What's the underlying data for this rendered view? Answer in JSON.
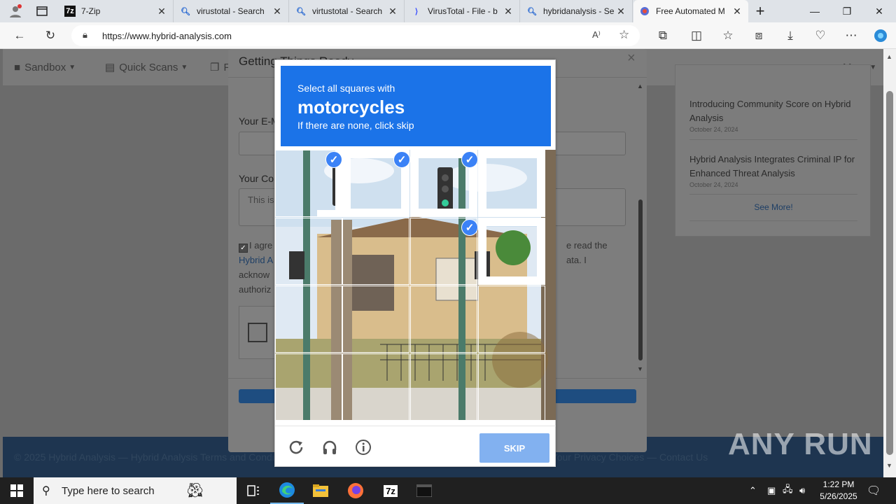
{
  "tabs": [
    {
      "label": "7-Zip",
      "icon": "7zip-icon"
    },
    {
      "label": "virustotal - Search",
      "icon": "search-icon"
    },
    {
      "label": "virtustotal - Search",
      "icon": "search-icon"
    },
    {
      "label": "VirusTotal - File - b",
      "icon": "virustotal-icon"
    },
    {
      "label": "hybridanalysis - Se",
      "icon": "search-icon"
    },
    {
      "label": "Free Automated M",
      "icon": "hybrid-analysis-icon"
    }
  ],
  "address": {
    "url": "https://www.hybrid-analysis.com"
  },
  "site_nav": {
    "sandbox": "Sandbox",
    "quick_scans": "Quick Scans",
    "files": "F",
    "more": "More"
  },
  "news": [
    {
      "title": "Introducing Community Score on Hybrid Analysis",
      "date": "October 24, 2024"
    },
    {
      "title": "Hybrid Analysis Integrates Criminal IP for Enhanced Threat Analysis",
      "date": "October 24, 2024"
    }
  ],
  "news_more": "See More!",
  "footer_text": "© 2025 Hybrid Analysis — Hybrid Analysis Terms and Conditions of Use — Hybrid Analysis Privacy Notice — Site Notice — Your Privacy Choices — Contact Us",
  "modal": {
    "title": "Getting Things Ready",
    "email_label": "Your E-M",
    "comment_label": "Your Co",
    "comment_placeholder": "This is",
    "agree_line1": "I agre",
    "agree_line1_end": "e read the",
    "agree_line2": "Hybrid A",
    "agree_line2_end": "ata. I",
    "agree_line3": "acknow",
    "agree_line4": "authoriz"
  },
  "captcha": {
    "instruction": "Select all squares with",
    "target": "motorcycles",
    "hint": "If there are none, click skip",
    "skip_label": "SKIP"
  },
  "taskbar": {
    "search_placeholder": "Type here to search",
    "time": "1:22 PM",
    "date": "5/26/2025"
  },
  "watermark": "ANY RUN"
}
